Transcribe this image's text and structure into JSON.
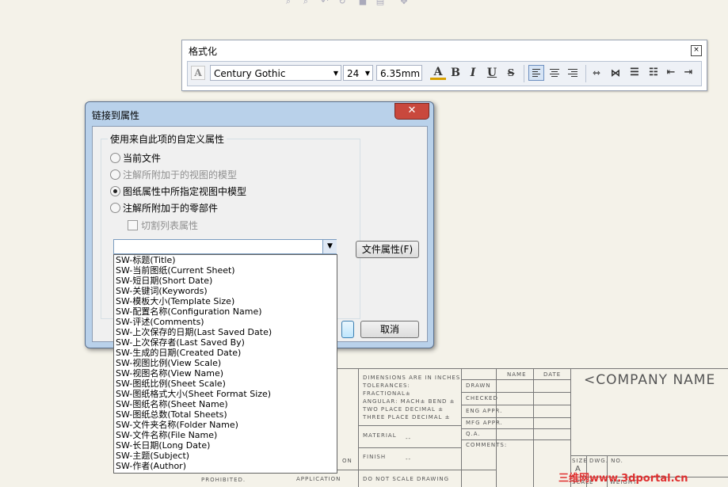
{
  "top_toolbar": {
    "icons": [
      "zoom-fit-icon",
      "zoom-area-icon",
      "previous-view-icon",
      "rotate-icon",
      "display-style-icon",
      "section-view-icon",
      "view-settings-icon"
    ]
  },
  "format_toolbar": {
    "title": "格式化",
    "close_glyph": "×",
    "font": "Century Gothic",
    "size": "24",
    "height": "6.35mm",
    "icons": {
      "style": "A",
      "color": "A",
      "bold": "B",
      "italic": "I",
      "underline": "U",
      "strike": "S"
    }
  },
  "dialog": {
    "title": "链接到属性",
    "close_glyph": "✕",
    "group_title": "使用来自此项的自定义属性",
    "options": [
      {
        "label": "当前文件",
        "checked": false,
        "enabled": true
      },
      {
        "label": "注解所附加于的视图的模型",
        "checked": false,
        "enabled": false
      },
      {
        "label": "图纸属性中所指定视图中模型",
        "checked": true,
        "enabled": true
      },
      {
        "label": "注解所附加于的零部件",
        "checked": false,
        "enabled": true
      }
    ],
    "checkbox_label": "切割列表属性",
    "file_props_button": "文件属性(F)",
    "cancel_button": "取消",
    "dropdown_value": "",
    "dropdown_items": [
      "SW-标题(Title)",
      "SW-当前图纸(Current Sheet)",
      "SW-短日期(Short Date)",
      "SW-关键词(Keywords)",
      "SW-模板大小(Template Size)",
      "SW-配置名称(Configuration Name)",
      "SW-评述(Comments)",
      "SW-上次保存的日期(Last Saved Date)",
      "SW-上次保存者(Last Saved By)",
      "SW-生成的日期(Created Date)",
      "SW-视图比例(View Scale)",
      "SW-视图名称(View Name)",
      "SW-图纸比例(Sheet Scale)",
      "SW-图纸格式大小(Sheet Format Size)",
      "SW-图纸名称(Sheet Name)",
      "SW-图纸总数(Total Sheets)",
      "SW-文件夹名称(Folder Name)",
      "SW-文件名称(File Name)",
      "SW-长日期(Long Date)",
      "SW-主题(Subject)",
      "SW-作者(Author)"
    ]
  },
  "title_block": {
    "dims_lines": [
      "DIMENSIONS ARE IN INCHES",
      "TOLERANCES:",
      "FRACTIONAL±",
      "ANGULAR: MACH±   BEND ±",
      "TWO PLACE DECIMAL   ±",
      "THREE PLACE DECIMAL  ±"
    ],
    "name_header": "NAME",
    "date_header": "DATE",
    "rows": [
      "DRAWN",
      "CHECKED",
      "ENG APPR.",
      "MFG APPR.",
      "Q.A.",
      "COMMENTS:"
    ],
    "material": "MATERIAL",
    "finish": "FINISH",
    "dash1": "--",
    "dash2": "--",
    "application": "APPLICATION",
    "do_not_scale": "DO NOT SCALE DRAWING",
    "prohibited": "PROHIBITED.",
    "on": "ON",
    "size": "SIZE",
    "size_letter": "A",
    "dwg_no": "DWG. NO.",
    "scale": "SCALE",
    "weight": "WEIGHT:",
    "company": "<COMPANY NAME"
  },
  "watermark": "三维网www.3dportal.cn"
}
